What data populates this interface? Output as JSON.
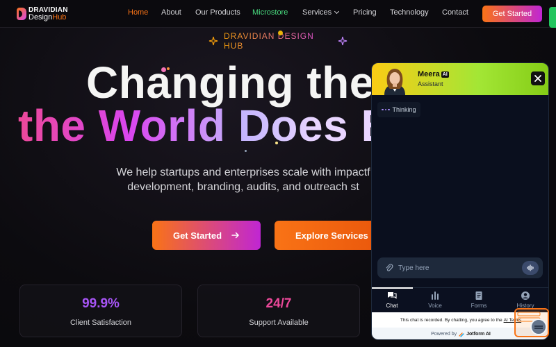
{
  "header": {
    "logo_line1": "DRAVIDIAN",
    "logo_line2a": "Design",
    "logo_line2b": "Hub",
    "nav": [
      "Home",
      "About",
      "Our Products",
      "Microstore",
      "Services",
      "Pricing",
      "Technology",
      "Contact"
    ],
    "cta": "Get Started"
  },
  "hero": {
    "tagline": "DRAVIDIAN DESIGN HUB",
    "title_line1": "Changing the",
    "title_line2": "the World Does B",
    "subtitle_line1": "We help startups and enterprises scale with impactf",
    "subtitle_line2": "development, branding, audits, and outreach st",
    "cta_primary": "Get Started",
    "cta_secondary": "Explore Services"
  },
  "stats": [
    {
      "value": "99.9%",
      "label": "Client Satisfaction",
      "color": "#a855f7"
    },
    {
      "value": "24/7",
      "label": "Support Available",
      "color": "#ec4899"
    }
  ],
  "chat": {
    "agent_name": "Meera",
    "badge": "AI",
    "role": "Assistant",
    "status": "Thinking",
    "input_placeholder": "Type here",
    "tabs": [
      "Chat",
      "Voice",
      "Forms",
      "History"
    ],
    "notice_text": "This chat is recorded. By chatting, you agree to the",
    "notice_link": "AI Terms",
    "powered_prefix": "Powered by",
    "powered_brand": "Jotform AI"
  },
  "colors": {
    "accent_orange": "#f97316",
    "accent_magenta": "#c026d3",
    "chat_header_start": "#facc15",
    "chat_header_end": "#84cc16"
  }
}
